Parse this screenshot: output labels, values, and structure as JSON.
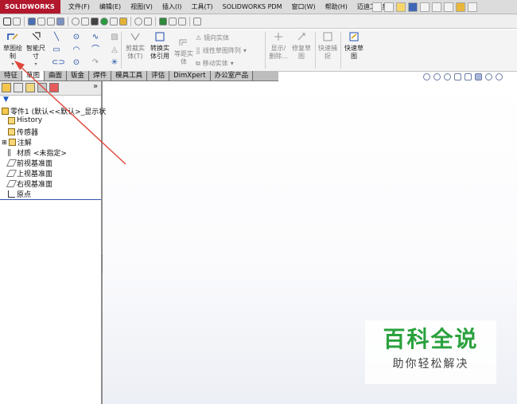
{
  "app": {
    "logo_text": "SOLIDWORKS"
  },
  "menu": [
    "文件(F)",
    "编辑(E)",
    "视图(V)",
    "插入(I)",
    "工具(T)",
    "SOLIDWORKS PDM",
    "窗口(W)",
    "帮助(H)",
    "迈迪工具集"
  ],
  "ribbon": {
    "sketch": "草图绘制",
    "smart_dim": "智能尺寸",
    "trim": "剪裁实体(T)",
    "convert": "转换实体引用",
    "offset": "等距实体",
    "mirror": "镜向实体",
    "linear_pattern": "线性草图阵列",
    "move": "移动实体",
    "show_delete": "显示/删除...",
    "repair": "修复草图",
    "quick_snap": "快速捕捉",
    "rapid_sketch": "快速草图"
  },
  "tabs": [
    "特征",
    "草图",
    "曲面",
    "钣金",
    "焊件",
    "模具工具",
    "评估",
    "DimXpert",
    "办公室产品"
  ],
  "active_tab": "草图",
  "tree": {
    "part": "零件1 (默认<<默认>_显示状",
    "items": [
      "History",
      "传感器",
      "注解",
      "材质 <未指定>",
      "前视基准面",
      "上视基准面",
      "右视基准面",
      "原点"
    ]
  },
  "watermark": {
    "title": "百科全说",
    "subtitle": "助你轻松解决"
  },
  "colors": {
    "brand": "#b2172c",
    "arrow": "#e0463a",
    "watermark_green": "#2aa13d"
  }
}
